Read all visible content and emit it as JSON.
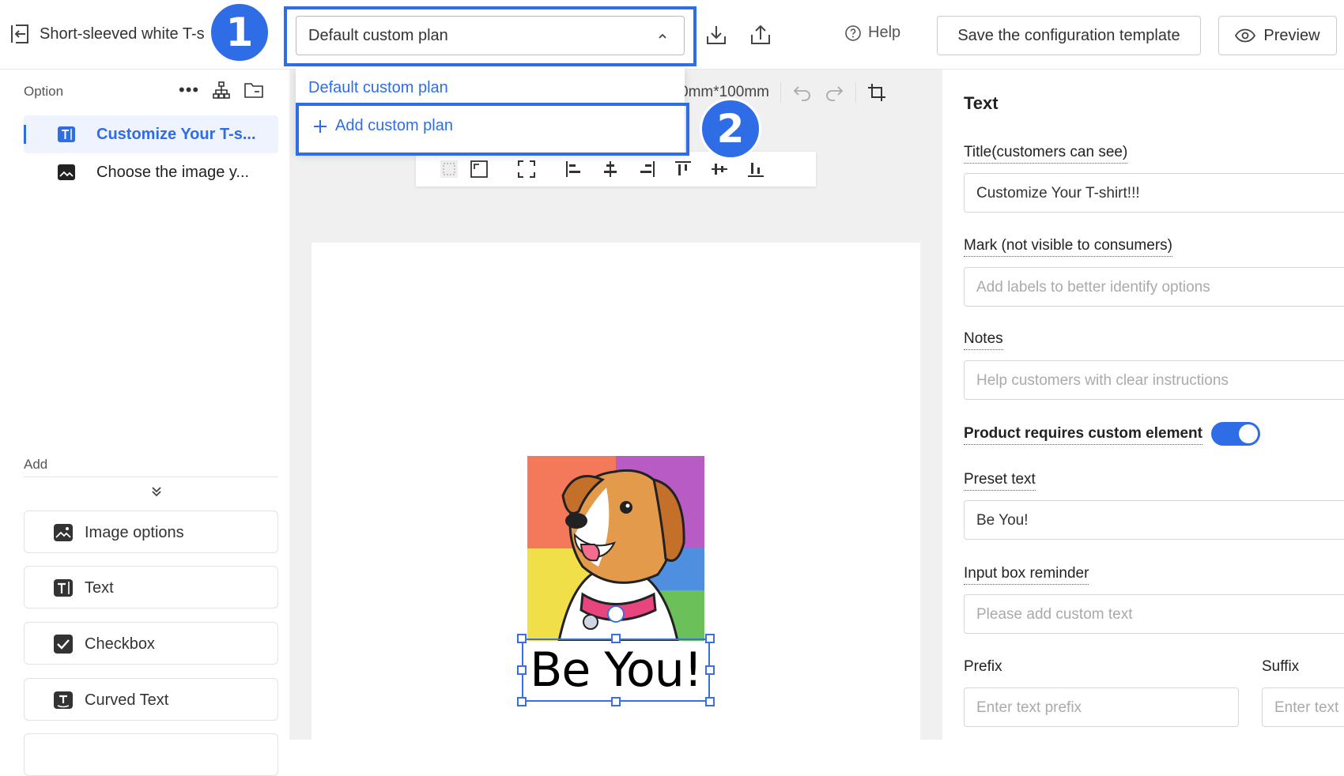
{
  "header": {
    "product_title": "Short-sleeved white T-s",
    "plan_select_value": "Default custom plan",
    "help_label": "Help",
    "save_template_label": "Save the configuration template",
    "preview_label": "Preview"
  },
  "badges": {
    "one": "1",
    "two": "2"
  },
  "dropdown": {
    "options": [
      "Default custom plan",
      "Add custom plan"
    ]
  },
  "sidebar": {
    "option_label": "Option",
    "options": [
      {
        "label": "Customize Your T-s...",
        "active": true,
        "icon": "text-icon"
      },
      {
        "label": "Choose the image y...",
        "active": false,
        "icon": "image-icon"
      }
    ],
    "add_label": "Add",
    "add_items": [
      {
        "label": "Image options",
        "icon": "image-icon"
      },
      {
        "label": "Text",
        "icon": "text-icon"
      },
      {
        "label": "Checkbox",
        "icon": "checkbox-icon"
      },
      {
        "label": "Curved Text",
        "icon": "curved-text-icon"
      }
    ]
  },
  "canvas": {
    "size_text": "0mm*100mm",
    "element_text": "Be You!"
  },
  "right_panel": {
    "title": "Text",
    "title_field": {
      "label": "Title(customers can see)",
      "value": "Customize Your T-shirt!!!"
    },
    "mark_field": {
      "label": "Mark (not visible to consumers)",
      "placeholder": "Add labels to better identify options"
    },
    "notes_field": {
      "label": "Notes",
      "placeholder": "Help customers with clear instructions"
    },
    "requires_custom": {
      "label": "Product requires custom element",
      "enabled": true
    },
    "preset_field": {
      "label": "Preset text",
      "value": "Be You!"
    },
    "reminder_field": {
      "label": "Input box reminder",
      "placeholder": "Please add custom text"
    },
    "prefix": {
      "label": "Prefix",
      "placeholder": "Enter text prefix"
    },
    "suffix": {
      "label": "Suffix",
      "placeholder": "Enter text"
    }
  },
  "colors": {
    "accent": "#2f6de6"
  }
}
